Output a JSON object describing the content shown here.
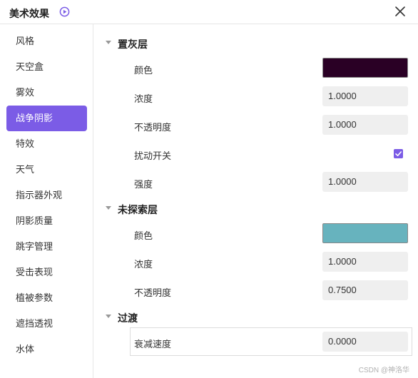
{
  "window": {
    "title": "美术效果"
  },
  "sidebar": {
    "items": [
      {
        "label": "风格"
      },
      {
        "label": "天空盒"
      },
      {
        "label": "雾效"
      },
      {
        "label": "战争阴影"
      },
      {
        "label": "特效"
      },
      {
        "label": "天气"
      },
      {
        "label": "指示器外观"
      },
      {
        "label": "阴影质量"
      },
      {
        "label": "跳字管理"
      },
      {
        "label": "受击表现"
      },
      {
        "label": "植被参数"
      },
      {
        "label": "遮挡透视"
      },
      {
        "label": "水体"
      }
    ],
    "active_index": 3,
    "active_color": "#7b5ce6"
  },
  "sections": {
    "gray_layer": {
      "title": "置灰层",
      "color_label": "颜色",
      "color_value": "#2a0025",
      "density_label": "浓度",
      "density_value": "1.0000",
      "opacity_label": "不透明度",
      "opacity_value": "1.0000",
      "perturb_label": "扰动开关",
      "perturb_checked": true,
      "strength_label": "强度",
      "strength_value": "1.0000"
    },
    "unexplored_layer": {
      "title": "未探索层",
      "color_label": "颜色",
      "color_value": "#67b3be",
      "density_label": "浓度",
      "density_value": "1.0000",
      "opacity_label": "不透明度",
      "opacity_value": "0.7500"
    },
    "transition": {
      "title": "过渡",
      "decay_label": "衰减速度",
      "decay_value": "0.0000"
    }
  },
  "watermark": "CSDN @神洛华"
}
